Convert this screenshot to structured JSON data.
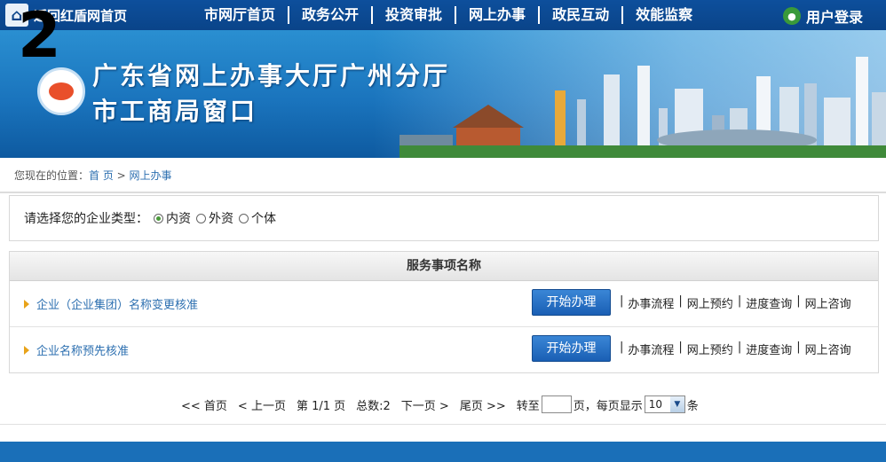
{
  "header": {
    "home_label": "返回红盾网首页",
    "nav": [
      "市网厅首页",
      "政务公开",
      "投资审批",
      "网上办事",
      "政民互动",
      "效能监察"
    ],
    "login_label": "用户登录"
  },
  "banner": {
    "overlay_number": "2",
    "title_line1": "广东省网上办事大厅广州分厅",
    "title_line2": "市工商局窗口"
  },
  "breadcrumb": {
    "prefix": "您现在的位置：",
    "home": "首 页",
    "sep": " > ",
    "current": "网上办事"
  },
  "enterprise_type": {
    "label": "请选择您的企业类型：",
    "options": [
      "内资",
      "外资",
      "个体"
    ],
    "selected": "内资"
  },
  "services": {
    "header": "服务事项名称",
    "start_label": "开始办理",
    "actions": [
      "办事流程",
      "网上预约",
      "进度查询",
      "网上咨询"
    ],
    "items": [
      "企业（企业集团）名称变更核准",
      "企业名称预先核准"
    ]
  },
  "pagination": {
    "first": "<< 首页",
    "prev": "< 上一页",
    "page_info": "第 1/1 页",
    "total": "总数:2",
    "next": "下一页 >",
    "last": "尾页 >>",
    "goto_label": "转至",
    "page_suffix": "页，每页显示",
    "per_page": "10",
    "unit": "条"
  },
  "colors": {
    "nav_bg": "#0a4489",
    "link": "#2c6fb0",
    "button": "#1a5fb4",
    "marker": "#e8a31a"
  }
}
